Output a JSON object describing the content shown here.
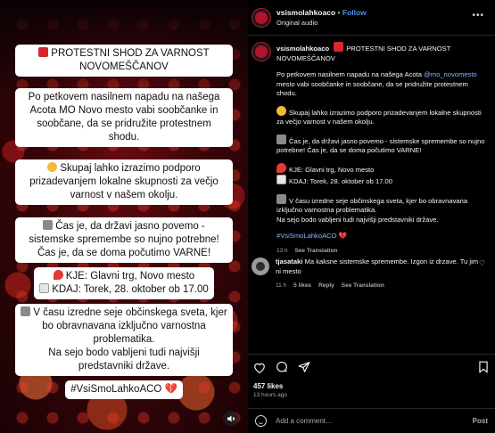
{
  "media": {
    "cards": [
      {
        "icon": "stop-sign-icon",
        "text": "PROTESTNI SHOD ZA VARNOST NOVOMEŠČANOV"
      },
      {
        "icon": "",
        "text": "Po petkovem nasilnem napadu na našega Acota MO Novo mesto vabi soobčanke in soobčane, da se pridružite protestnem shodu."
      },
      {
        "icon": "fist-icon",
        "text": "Skupaj lahko izrazimo podporo prizadevanjem lokalne skupnosti za večjo varnost v našem okolju."
      },
      {
        "icon": "megaphone-icon",
        "text": "Čas je, da državi jasno povemo - sistemske spremembe so nujno potrebne! Čas je, da se doma počutimo VARNE!"
      },
      {
        "icon": "pin-icon",
        "text": "KJE: Glavni trg, Novo mesto"
      },
      {
        "icon": "calendar-icon",
        "text": "KDAJ: Torek, 28. oktober ob 17.00"
      },
      {
        "icon": "building-icon",
        "text": "V času izredne seje občinskega sveta, kjer bo obravnavana izključno varnostna problematika."
      },
      {
        "icon": "",
        "text": "Na sejo bodo vabljeni tudi najvišji predstavniki države."
      },
      {
        "icon": "",
        "text": "#VsiSmoLahkoACO 💔"
      }
    ]
  },
  "header": {
    "username": "vsismolahkoaco",
    "separator": "•",
    "follow": "Follow",
    "audio": "Original audio"
  },
  "caption": {
    "username": "vsismolahkoaco",
    "title": "PROTESTNI SHOD ZA VARNOST NOVOMEŠČANOV",
    "p1_pre": "Po petkovem nasilnem napadu na našega Acota ",
    "p1_mention": "@mo_novomesto",
    "p1_post": " mesto vabi soobčanke in soobčane, da se pridružite protestnem shodu.",
    "p2": "Skupaj lahko izrazimo podporo prizadevanjem lokalne skupnosti za večjo varnost v našem okolju.",
    "p3": "Čas je, da državi jasno povemo - sistemske spremembe so nujno potrebne! Čas je, da se doma počutimo VARNE!",
    "p4a": "KJE: Glavni trg, Novo mesto",
    "p4b": "KDAJ: Torek, 28. oktober ob 17.00",
    "p5a": "V času izredne seje občinskega sveta, kjer bo obravnavana izključno varnostna problematika.",
    "p5b": "Na sejo bodo vabljeni tudi najvišji predstavniki države.",
    "hashtag": "#VsiSmoLahkoACO",
    "age": "13 h",
    "see_translation": "See Translation"
  },
  "comment": {
    "username": "tjasataki",
    "text": "Ma kaksne sistemske spremembe. Izgon iz drzave. Tu jim ni mesto",
    "age": "11 h",
    "likes": "5 likes",
    "reply": "Reply",
    "see_translation": "See Translation"
  },
  "actions": {
    "likes": "457 likes",
    "time": "13 hours ago"
  },
  "composer": {
    "placeholder": "Add a comment…",
    "post": "Post"
  },
  "colors": {
    "accent_link": "#4a90e2",
    "background": "#000000",
    "card": "#ffffff"
  }
}
